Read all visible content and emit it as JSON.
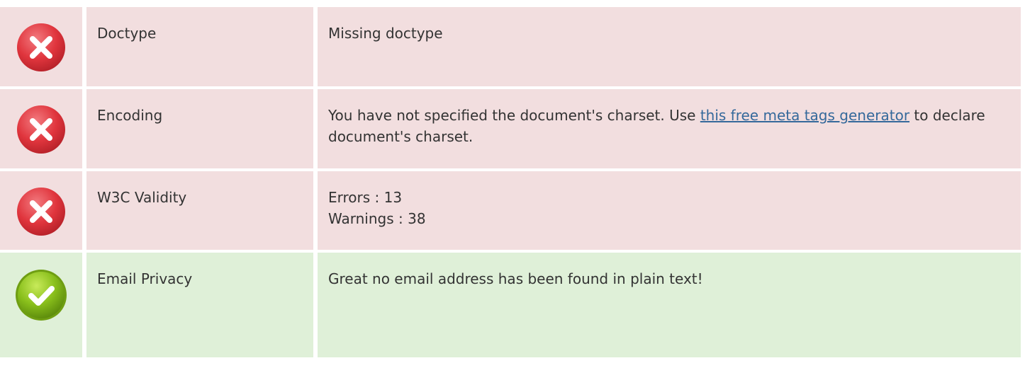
{
  "colors": {
    "error_bg": "#f2dedf",
    "success_bg": "#dff0d8",
    "error_icon": "#e0353d",
    "success_icon": "#8ac01c",
    "link": "#35699b"
  },
  "rows": [
    {
      "status": "error",
      "icon": "error-x-icon",
      "name": "Doctype",
      "value": "Missing doctype"
    },
    {
      "status": "error",
      "icon": "error-x-icon",
      "name": "Encoding",
      "value_prefix": "You have not specified the document's charset. Use ",
      "value_link": "this free meta tags generator",
      "value_suffix": " to declare document's charset."
    },
    {
      "status": "error",
      "icon": "error-x-icon",
      "name": "W3C Validity",
      "value_lines": [
        "Errors : 13",
        "Warnings : 38"
      ]
    },
    {
      "status": "success",
      "icon": "success-check-icon",
      "name": "Email Privacy",
      "value": "Great no email address has been found in plain text!"
    }
  ]
}
